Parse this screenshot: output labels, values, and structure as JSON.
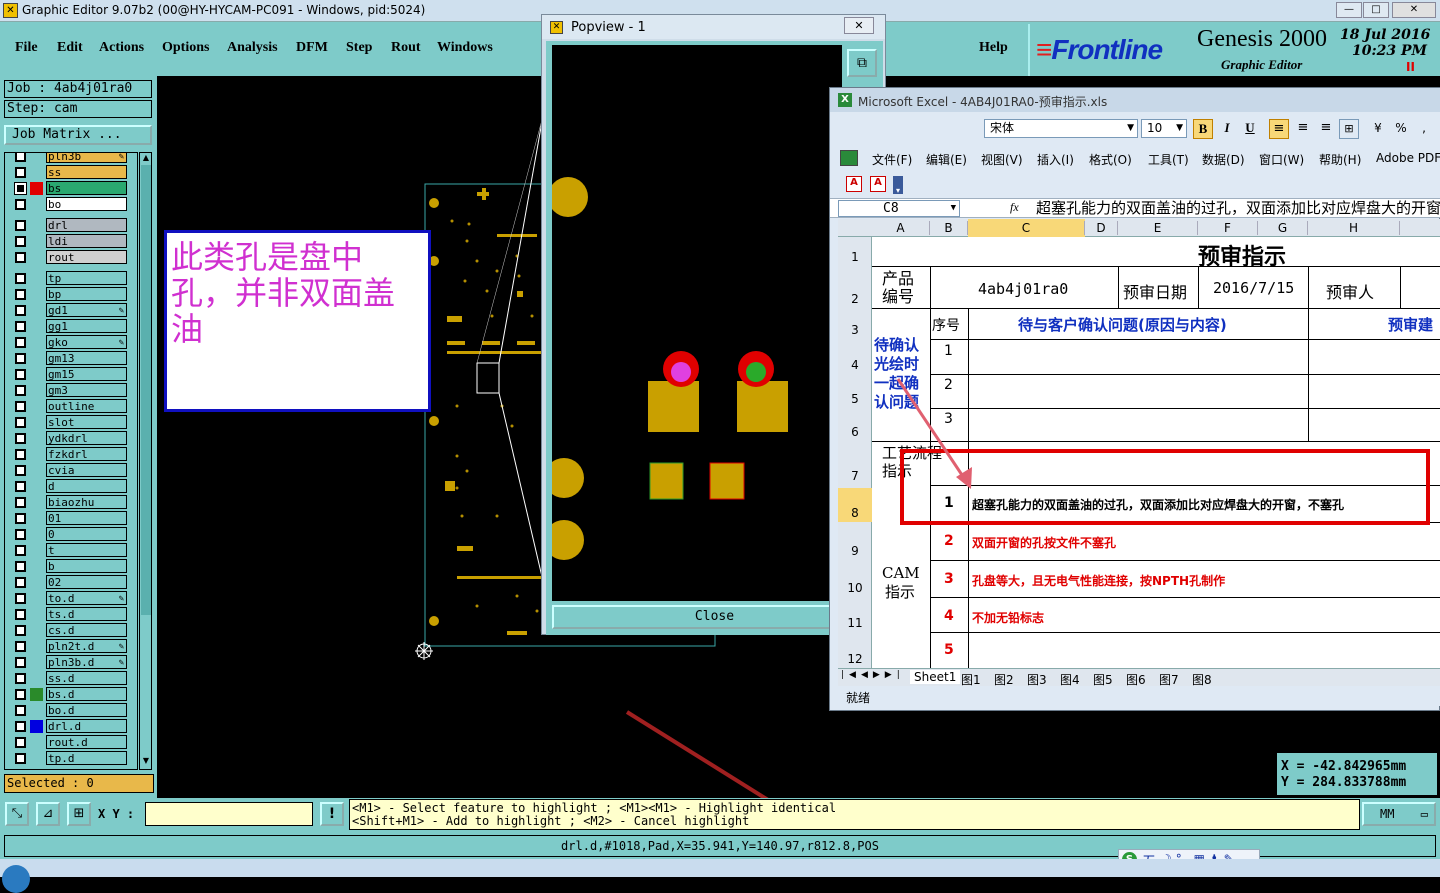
{
  "window": {
    "title": "Graphic Editor 9.07b2 (00@HY-HYCAM-PC091 - Windows, pid:5024)"
  },
  "menu": [
    "File",
    "Edit",
    "Actions",
    "Options",
    "Analysis",
    "DFM",
    "Step",
    "Rout",
    "Windows"
  ],
  "help": "Help",
  "brand": {
    "logo": "Frontline",
    "product": "Genesis 2000",
    "sub": "Graphic Editor",
    "date": "18 Jul 2016",
    "time": "10:23 PM",
    "pause": "II"
  },
  "job": {
    "job_label": "Job : 4ab4j01ra0",
    "step_label": "Step: cam",
    "matrix_button": "Job Matrix ..."
  },
  "layers": [
    {
      "name": "pln3b",
      "bg": "#e8b84a",
      "chk": false,
      "color": "",
      "edit": true
    },
    {
      "name": "ss",
      "bg": "#e8b84a",
      "chk": false,
      "color": "",
      "edit": false
    },
    {
      "name": "bs",
      "bg": "#2aa870",
      "chk": true,
      "color": "#e00000",
      "edit": false
    },
    {
      "name": "bo",
      "bg": "#ffffff",
      "chk": false,
      "color": "",
      "edit": false
    },
    {
      "name": "drl",
      "bg": "#b0b8c0",
      "chk": false,
      "color": "",
      "edit": false
    },
    {
      "name": "ldi",
      "bg": "#b0b8c0",
      "chk": false,
      "color": "",
      "edit": false
    },
    {
      "name": "rout",
      "bg": "#d0d0d0",
      "chk": false,
      "color": "",
      "edit": false
    },
    {
      "name": "tp",
      "bg": "#7ecbc9",
      "chk": false,
      "color": "",
      "edit": false
    },
    {
      "name": "bp",
      "bg": "#7ecbc9",
      "chk": false,
      "color": "",
      "edit": false
    },
    {
      "name": "gd1",
      "bg": "#7ecbc9",
      "chk": false,
      "color": "",
      "edit": true
    },
    {
      "name": "gg1",
      "bg": "#7ecbc9",
      "chk": false,
      "color": "",
      "edit": false
    },
    {
      "name": "gko",
      "bg": "#7ecbc9",
      "chk": false,
      "color": "",
      "edit": true
    },
    {
      "name": "gm13",
      "bg": "#7ecbc9",
      "chk": false,
      "color": "",
      "edit": false
    },
    {
      "name": "gm15",
      "bg": "#7ecbc9",
      "chk": false,
      "color": "",
      "edit": false
    },
    {
      "name": "gm3",
      "bg": "#7ecbc9",
      "chk": false,
      "color": "",
      "edit": false
    },
    {
      "name": "outline",
      "bg": "#7ecbc9",
      "chk": false,
      "color": "",
      "edit": false
    },
    {
      "name": "slot",
      "bg": "#7ecbc9",
      "chk": false,
      "color": "",
      "edit": false
    },
    {
      "name": "ydkdrl",
      "bg": "#7ecbc9",
      "chk": false,
      "color": "",
      "edit": false
    },
    {
      "name": "fzkdrl",
      "bg": "#7ecbc9",
      "chk": false,
      "color": "",
      "edit": false
    },
    {
      "name": "cvia",
      "bg": "#7ecbc9",
      "chk": false,
      "color": "",
      "edit": false
    },
    {
      "name": "d",
      "bg": "#7ecbc9",
      "chk": false,
      "color": "",
      "edit": false
    },
    {
      "name": "biaozhu",
      "bg": "#7ecbc9",
      "chk": false,
      "color": "",
      "edit": false
    },
    {
      "name": "01",
      "bg": "#7ecbc9",
      "chk": false,
      "color": "",
      "edit": false
    },
    {
      "name": "0",
      "bg": "#7ecbc9",
      "chk": false,
      "color": "",
      "edit": false
    },
    {
      "name": "t",
      "bg": "#7ecbc9",
      "chk": false,
      "color": "",
      "edit": false
    },
    {
      "name": "b",
      "bg": "#7ecbc9",
      "chk": false,
      "color": "",
      "edit": false
    },
    {
      "name": "02",
      "bg": "#7ecbc9",
      "chk": false,
      "color": "",
      "edit": false
    },
    {
      "name": "to.d",
      "bg": "#7ecbc9",
      "chk": false,
      "color": "",
      "edit": true
    },
    {
      "name": "ts.d",
      "bg": "#7ecbc9",
      "chk": false,
      "color": "",
      "edit": false
    },
    {
      "name": "cs.d",
      "bg": "#7ecbc9",
      "chk": false,
      "color": "",
      "edit": false
    },
    {
      "name": "pln2t.d",
      "bg": "#7ecbc9",
      "chk": false,
      "color": "",
      "edit": true
    },
    {
      "name": "pln3b.d",
      "bg": "#7ecbc9",
      "chk": false,
      "color": "",
      "edit": true
    },
    {
      "name": "ss.d",
      "bg": "#7ecbc9",
      "chk": false,
      "color": "",
      "edit": false
    },
    {
      "name": "bs.d",
      "bg": "#7ecbc9",
      "chk": false,
      "color": "#2a8a2a",
      "edit": false
    },
    {
      "name": "bo.d",
      "bg": "#7ecbc9",
      "chk": false,
      "color": "",
      "edit": false
    },
    {
      "name": "drl.d",
      "bg": "#7ecbc9",
      "chk": false,
      "color": "#0000e0",
      "edit": false
    },
    {
      "name": "rout.d",
      "bg": "#7ecbc9",
      "chk": false,
      "color": "",
      "edit": false
    },
    {
      "name": "tp.d",
      "bg": "#7ecbc9",
      "chk": false,
      "color": "",
      "edit": false
    }
  ],
  "selected": "Selected : 0",
  "annotation": {
    "text": "此类孔是盘中孔，并非双面盖油"
  },
  "popview": {
    "title": "Popview - 1",
    "close": "Close"
  },
  "excel": {
    "title": "Microsoft Excel - 4AB4J01RA0-预审指示.xls",
    "font": "宋体",
    "size": "10",
    "menus": [
      "文件(F)",
      "编辑(E)",
      "视图(V)",
      "插入(I)",
      "格式(O)",
      "工具(T)",
      "数据(D)",
      "窗口(W)",
      "帮助(H)",
      "Adobe PDF"
    ],
    "cellref": "C8",
    "fx": "fx",
    "formula": "超塞孔能力的双面盖油的过孔，双面添加比对应焊盘大的开窗，不塞孔",
    "cols": [
      "A",
      "B",
      "C",
      "D",
      "E",
      "F",
      "G",
      "H"
    ],
    "rows": [
      "1",
      "2",
      "3",
      "4",
      "5",
      "6",
      "7",
      "8",
      "9",
      "10",
      "11",
      "12"
    ],
    "heading": "预审指示",
    "product_label": "产品编号",
    "product_value": "4ab4j01ra0",
    "date_label": "预审日期",
    "date_value": "2016/7/15",
    "reviewer_label": "预审人",
    "seq_label": "序号",
    "issue_header": "待与客户确认问题(原因与内容)",
    "suggest_header": "预审建",
    "confirm_label": "待确认光绘时一起确认问题",
    "confirm_nums": [
      "1",
      "2",
      "3"
    ],
    "process_label": "工艺流程指示",
    "cam_label": "CAM指示",
    "cam_nums": [
      "1",
      "2",
      "3",
      "4",
      "5"
    ],
    "cam_items": [
      "超塞孔能力的双面盖油的过孔，双面添加比对应焊盘大的开窗，不塞孔",
      "双面开窗的孔按文件不塞孔",
      "孔盘等大，且无电气性能连接，按NPTH孔制作",
      "不加无铅标志",
      ""
    ],
    "sheets": [
      "Sheet1",
      "图1",
      "图2",
      "图3",
      "图4",
      "图5",
      "图6",
      "图7",
      "图8"
    ],
    "status": "就绪"
  },
  "coords": {
    "x": "X  =  -42.842965mm",
    "y": "Y  =  284.833788mm"
  },
  "bottom": {
    "xy_label": "X Y :",
    "hint1": "<M1> - Select feature to highlight ; <M1><M1> - Highlight identical",
    "hint2": "<Shift+M1> - Add to highlight ; <M2> - Cancel highlight",
    "units": "MM",
    "status": "drl.d,#1018,Pad,X=35.941,Y=140.97,r812.8,POS"
  },
  "ime": {
    "label": "五"
  }
}
